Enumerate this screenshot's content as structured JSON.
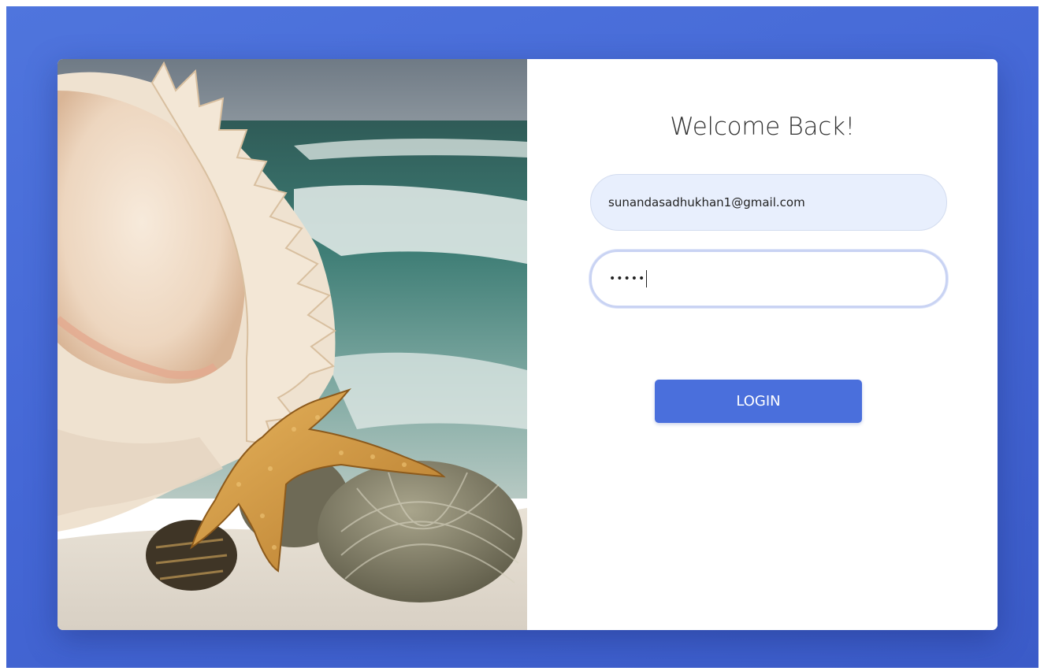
{
  "login": {
    "title": "Welcome Back!",
    "email_value": "sunandasadhukhan1@gmail.com",
    "password_masked": "•••••",
    "login_label": "LOGIN"
  },
  "colors": {
    "background_blue": "#4568d6",
    "button_blue": "#4a6fdc",
    "email_field_fill": "#e8effd",
    "focused_field_border": "#c9d3f3"
  },
  "image": {
    "description_icon": "beach-seashell-photo"
  }
}
